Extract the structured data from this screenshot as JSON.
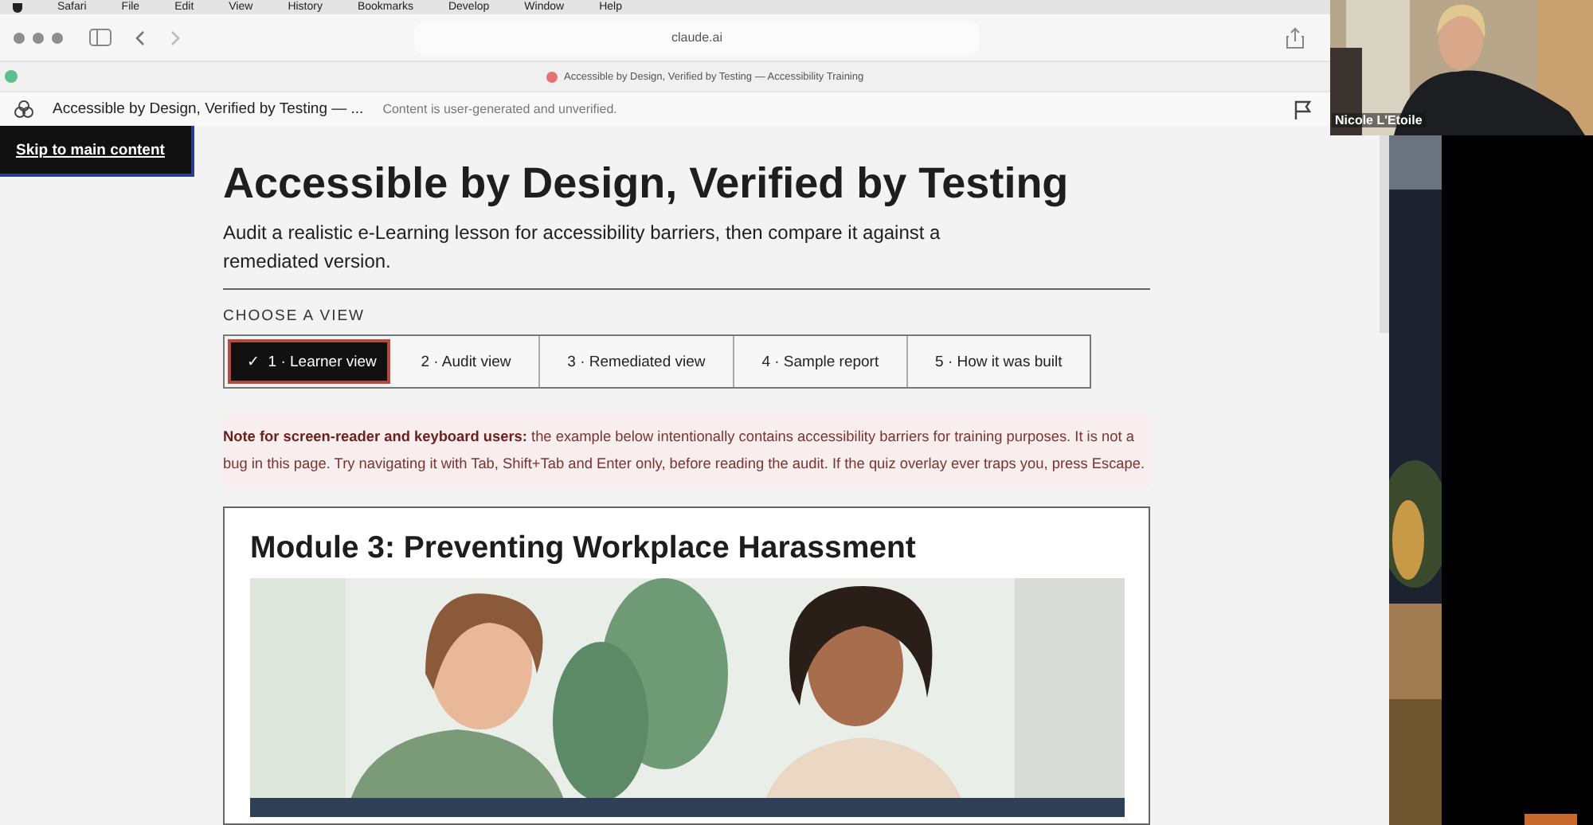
{
  "menu_bar": [
    "Safari",
    "File",
    "Edit",
    "View",
    "History",
    "Bookmarks",
    "Develop",
    "Window",
    "Help"
  ],
  "browser": {
    "address": "claude.ai",
    "tab_title": "Accessible by Design, Verified by Testing — Accessibility Training"
  },
  "artifact_bar": {
    "title": "Accessible by Design, Verified by Testing — ...",
    "notice": "Content is user-generated and unverified."
  },
  "skip_link": "Skip to main content",
  "page": {
    "title": "Accessible by Design, Verified by Testing",
    "subtitle": "Audit a realistic e-Learning lesson for accessibility barriers, then compare it against a remediated version."
  },
  "views": {
    "label": "CHOOSE A VIEW",
    "tabs": [
      {
        "label": "1 · Learner view",
        "mark": "✓",
        "selected": true
      },
      {
        "label": "2 · Audit view",
        "selected": false
      },
      {
        "label": "3 · Remediated view",
        "selected": false
      },
      {
        "label": "4 · Sample report",
        "selected": false
      },
      {
        "label": "5 · How it was built",
        "selected": false
      }
    ]
  },
  "note": "**Note for screen-reader and keyboard users:** the example below intentionally contains accessibility barriers for training purposes. It is not a bug in this page. Try navigating it with Tab, Shift+Tab and Enter only, before reading the audit. If the quiz overlay ever traps you, press Escape.",
  "module": {
    "title": "Module 3: Preventing Workplace Harassment"
  },
  "video_call": {
    "participant": "Nicole L'Etoile"
  }
}
